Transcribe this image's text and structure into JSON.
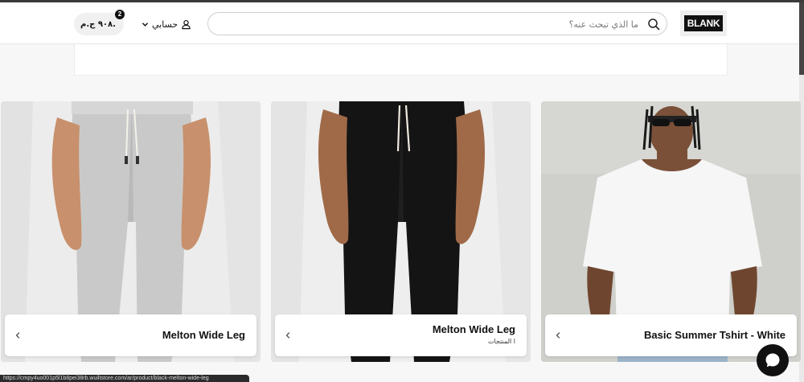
{
  "brand": {
    "logo_text": "BLANK"
  },
  "search": {
    "placeholder": "ما الذي تبحث عنه؟",
    "value": ""
  },
  "account": {
    "label": "حسابي"
  },
  "cart": {
    "total": "٩٠٨ ج.م.",
    "count": "2"
  },
  "products": [
    {
      "title": "Melton Wide Leg",
      "subtitle": ""
    },
    {
      "title": "Melton Wide Leg",
      "subtitle": "ا المنتجات"
    },
    {
      "title": "Basic Summer Tshirt - White",
      "subtitle": ""
    }
  ],
  "status_bar": {
    "url": "https://cmpy4uo001p5l1b8pei38rb.wuiltstore.com/ar/product/black-melton-wide-leg"
  },
  "icons": [
    "search-icon",
    "user-icon",
    "chevron-down-icon",
    "cart-icon",
    "chevron-left-icon",
    "chat-icon"
  ],
  "colors": {
    "accent": "#111111",
    "page_bg": "#f7f7f7",
    "header_bg": "#ffffff"
  }
}
